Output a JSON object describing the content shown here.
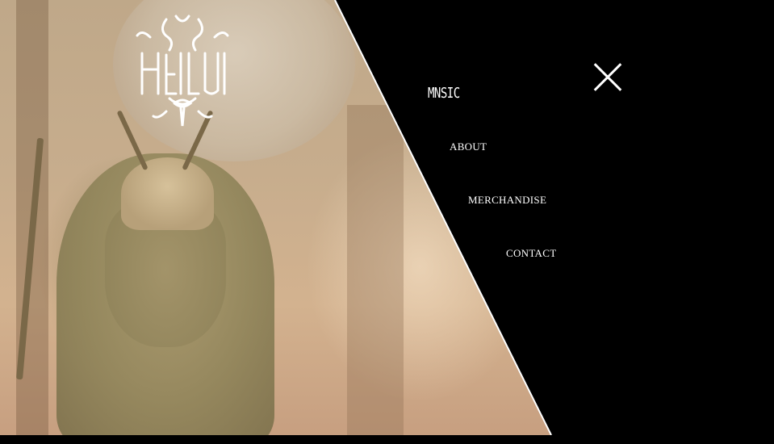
{
  "logo": {
    "alt": "Heilung",
    "icon": "heilung-logo-icon"
  },
  "menu": {
    "items": [
      {
        "key": "music",
        "label": "MNSIC"
      },
      {
        "key": "about",
        "label": "ABOUT"
      },
      {
        "key": "merchandise",
        "label": "MERCHANDISE"
      },
      {
        "key": "contact",
        "label": "CONTACT"
      }
    ],
    "close_icon": "close-icon"
  },
  "colors": {
    "menu_background": "#000000",
    "menu_text": "#ffffff",
    "photo_tint": "#c7ad8d"
  }
}
